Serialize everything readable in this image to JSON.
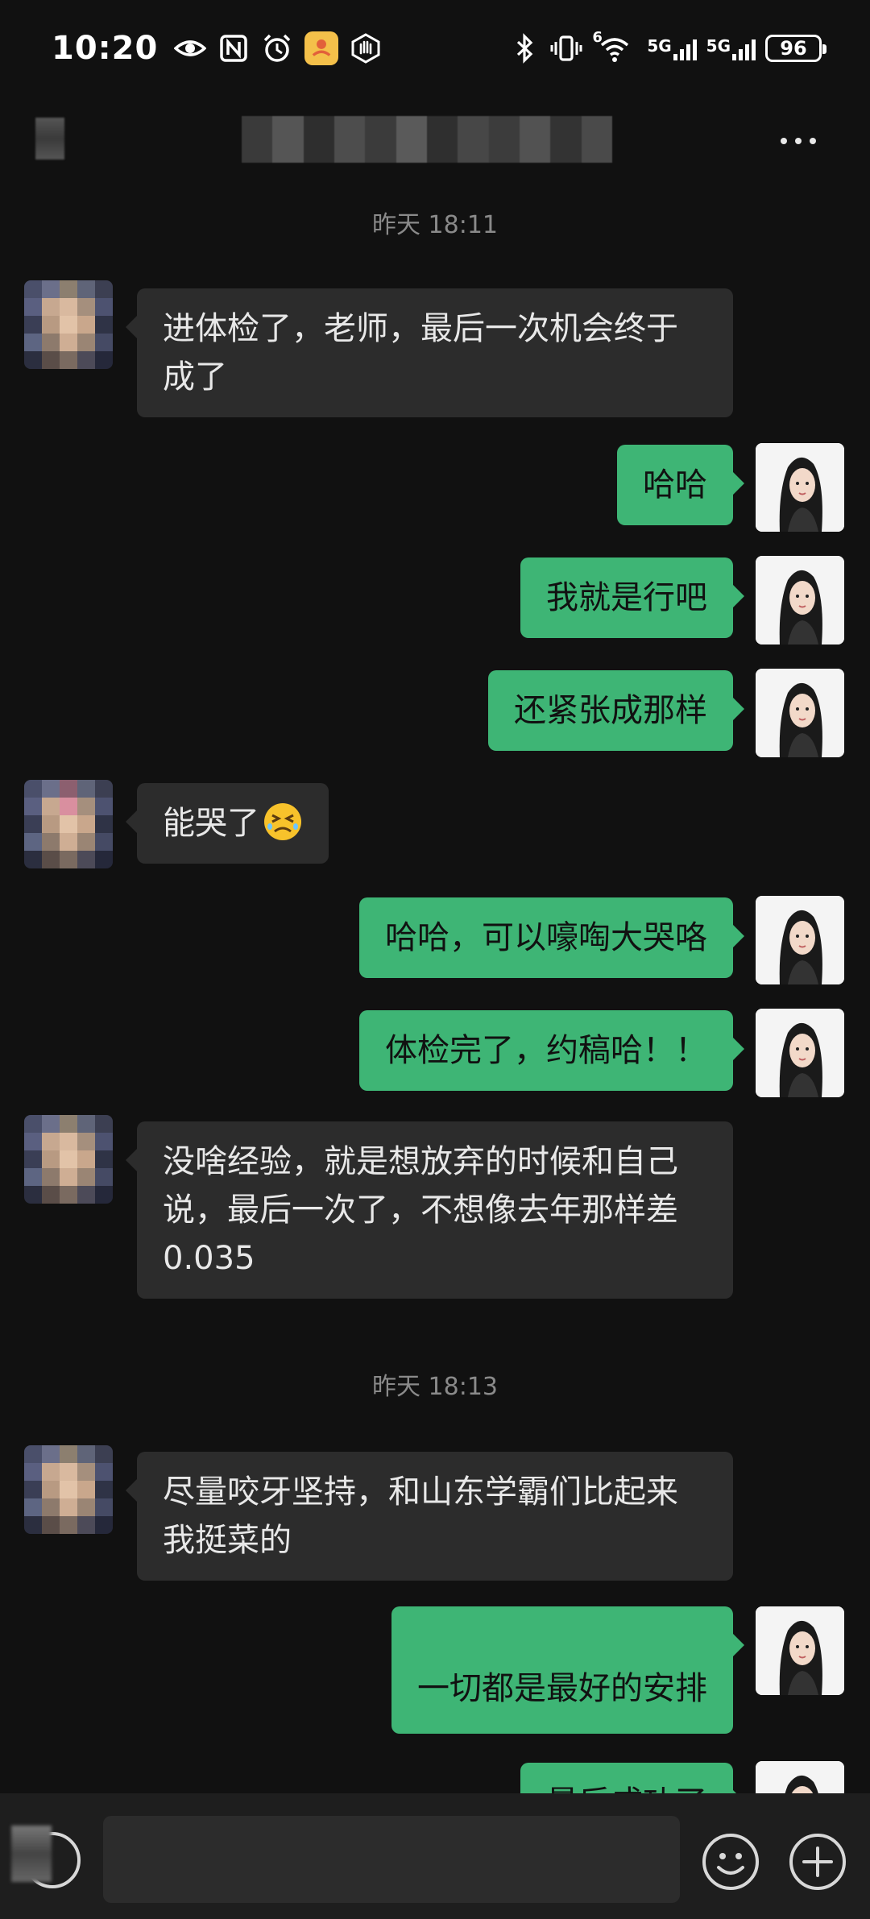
{
  "status_bar": {
    "time": "10:20",
    "icons_left": [
      "eye-icon",
      "nfc-icon",
      "alarm-icon",
      "app-notification-icon",
      "hand-icon"
    ],
    "icons_right": [
      "bluetooth-icon",
      "vibrate-icon",
      "wifi-icon",
      "signal-5g-icon",
      "signal-5g-icon",
      "battery-icon"
    ],
    "wifi_label": "6",
    "network_label_1": "5G",
    "network_label_2": "5G",
    "battery": "96"
  },
  "chat_header": {
    "back_icon": "back-icon",
    "more_icon": "more-icon"
  },
  "messages": [
    {
      "type": "timestamp",
      "text": "昨天 18:11"
    },
    {
      "type": "received",
      "text": "进体检了，老师，最后一次机会终于成了"
    },
    {
      "type": "sent",
      "text": "哈哈"
    },
    {
      "type": "sent",
      "text": "我就是行吧"
    },
    {
      "type": "sent",
      "text": "还紧张成那样"
    },
    {
      "type": "received",
      "text": "能哭了",
      "emoji": "persevering-face"
    },
    {
      "type": "sent",
      "text": "哈哈，可以嚎啕大哭咯"
    },
    {
      "type": "sent",
      "text": "体检完了，约稿哈！！"
    },
    {
      "type": "received",
      "text": "没啥经验，就是想放弃的时候和自己说，最后一次了，不想像去年那样差 0.035"
    },
    {
      "type": "timestamp",
      "text": "昨天 18:13"
    },
    {
      "type": "received",
      "text": "尽量咬牙坚持，和山东学霸们比起来我挺菜的"
    },
    {
      "type": "sent",
      "text": "一切都是最好的安排"
    },
    {
      "type": "sent",
      "text": "最后成功了"
    }
  ],
  "input_bar": {
    "voice_icon": "voice-icon",
    "emoji_icon": "emoji-icon",
    "plus_icon": "plus-icon"
  },
  "colors": {
    "background": "#111111",
    "sent_bubble": "#3eb575",
    "received_bubble": "#2c2c2c",
    "timestamp_text": "#8a8a8a"
  }
}
